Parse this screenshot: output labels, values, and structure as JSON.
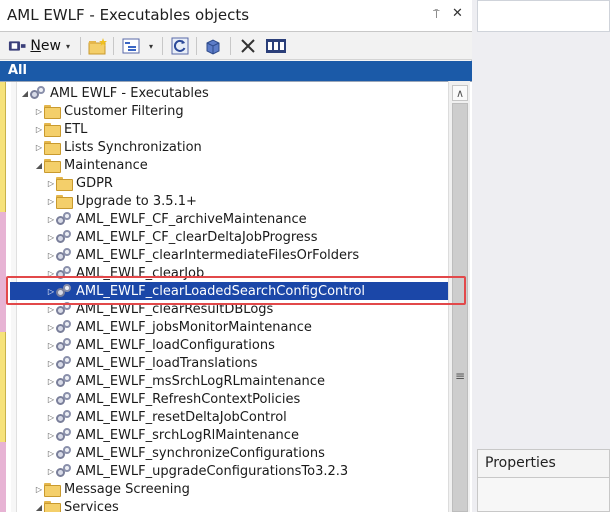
{
  "panel": {
    "title": "AML EWLF - Executables objects",
    "pin_glyph": "⍑",
    "close_glyph": "✕"
  },
  "toolbar": {
    "new_label": "New",
    "caret": "▾"
  },
  "filter": {
    "label": "All"
  },
  "tree": {
    "root": "AML EWLF - Executables",
    "items": [
      {
        "label": "Customer Filtering"
      },
      {
        "label": "ETL"
      },
      {
        "label": "Lists Synchronization"
      },
      {
        "label": "Maintenance"
      },
      {
        "label": "GDPR"
      },
      {
        "label": "Upgrade to 3.5.1+"
      },
      {
        "label": "AML_EWLF_CF_archiveMaintenance"
      },
      {
        "label": "AML_EWLF_CF_clearDeltaJobProgress"
      },
      {
        "label": "AML_EWLF_clearIntermediateFilesOrFolders"
      },
      {
        "label": "AML_EWLF_clearJob"
      },
      {
        "label": "AML_EWLF_clearLoadedSearchConfigControl"
      },
      {
        "label": "AML_EWLF_clearResultDBLogs"
      },
      {
        "label": "AML_EWLF_jobsMonitorMaintenance"
      },
      {
        "label": "AML_EWLF_loadConfigurations"
      },
      {
        "label": "AML_EWLF_loadTranslations"
      },
      {
        "label": "AML_EWLF_msSrchLogRLmaintenance"
      },
      {
        "label": "AML_EWLF_RefreshContextPolicies"
      },
      {
        "label": "AML_EWLF_resetDeltaJobControl"
      },
      {
        "label": "AML_EWLF_srchLogRlMaintenance"
      },
      {
        "label": "AML_EWLF_synchronizeConfigurations"
      },
      {
        "label": "AML_EWLF_upgradeConfigurationsTo3.2.3"
      },
      {
        "label": "Message Screening"
      },
      {
        "label": "Services"
      }
    ],
    "expander_collapsed": "▷",
    "expander_expanded": "◢",
    "scroll_up": "∧",
    "scroll_grip": "≡"
  },
  "properties": {
    "title": "Properties"
  }
}
